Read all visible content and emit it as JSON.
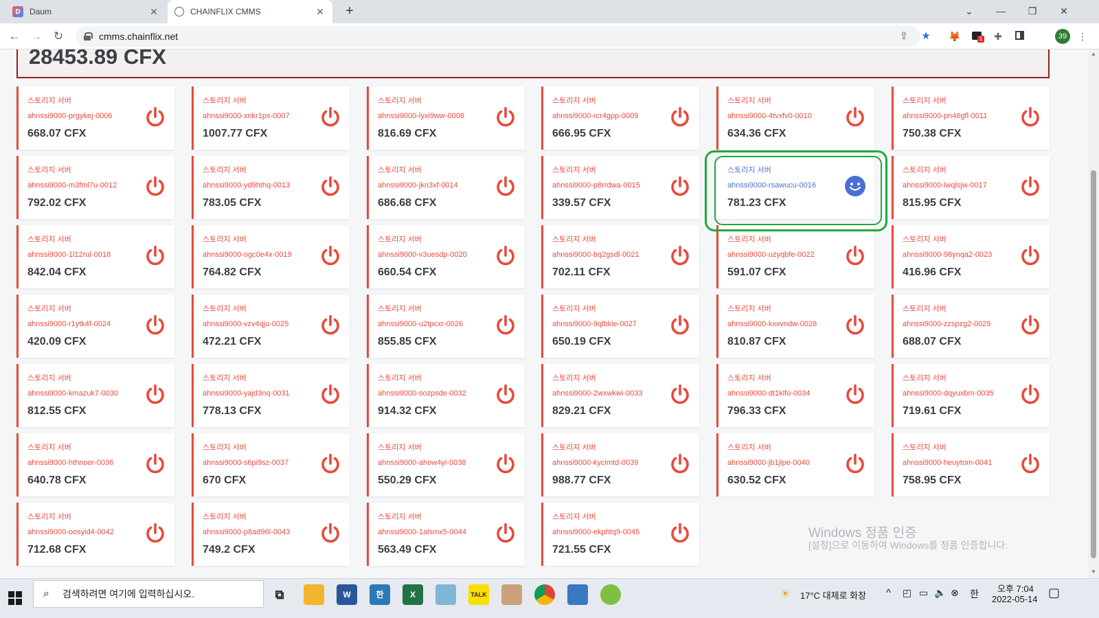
{
  "browser": {
    "tabs": [
      {
        "title": "Daum",
        "active": false,
        "favicon": "daum-icon"
      },
      {
        "title": "CHAINFLIX CMMS",
        "active": true,
        "favicon": "globe-icon"
      }
    ],
    "url": "cmms.chainflix.net",
    "profile_initials": "39",
    "extension_badge": "1"
  },
  "page": {
    "total_balance": "28453.89 CFX",
    "cards": [
      {
        "type": "스토리지 서버",
        "name": "ahnssi9000-prgykej-0006",
        "amount": "668.07 CFX",
        "status": "off"
      },
      {
        "type": "스토리지 서버",
        "name": "ahnssi9000-xnkr1ps-0007",
        "amount": "1007.77 CFX",
        "status": "off"
      },
      {
        "type": "스토리지 서버",
        "name": "ahnssi9000-lyxi9ww-0008",
        "amount": "816.69 CFX",
        "status": "off"
      },
      {
        "type": "스토리지 서버",
        "name": "ahnssi9000-rcr4gpp-0009",
        "amount": "666.95 CFX",
        "status": "off"
      },
      {
        "type": "스토리지 서버",
        "name": "ahnssi9000-4tvxfv0-0010",
        "amount": "634.36 CFX",
        "status": "off"
      },
      {
        "type": "스토리지 서버",
        "name": "ahnssi9000-pn46gfl-0011",
        "amount": "750.38 CFX",
        "status": "off"
      },
      {
        "type": "스토리지 서버",
        "name": "ahnssi9000-m3fml7u-0012",
        "amount": "792.02 CFX",
        "status": "off"
      },
      {
        "type": "스토리지 서버",
        "name": "ahnssi9000-yd9hthq-0013",
        "amount": "783.05 CFX",
        "status": "off"
      },
      {
        "type": "스토리지 서버",
        "name": "ahnssi9000-jkri3xf-0014",
        "amount": "686.68 CFX",
        "status": "off"
      },
      {
        "type": "스토리지 서버",
        "name": "ahnssi9000-p8rrdwa-0015",
        "amount": "339.57 CFX",
        "status": "off"
      },
      {
        "type": "스토리지 서버",
        "name": "ahnssi9000-rsawucu-0016",
        "amount": "781.23 CFX",
        "status": "on"
      },
      {
        "type": "스토리지 서버",
        "name": "ahnssi9000-lwqlsjw-0017",
        "amount": "815.95 CFX",
        "status": "off"
      },
      {
        "type": "스토리지 서버",
        "name": "ahnssi9000-1l12rul-0018",
        "amount": "842.04 CFX",
        "status": "off"
      },
      {
        "type": "스토리지 서버",
        "name": "ahnssi9000-ogc0e4x-0019",
        "amount": "764.82 CFX",
        "status": "off"
      },
      {
        "type": "스토리지 서버",
        "name": "ahnssi9000-v3uesdp-0020",
        "amount": "660.54 CFX",
        "status": "off"
      },
      {
        "type": "스토리지 서버",
        "name": "ahnssi9000-bq2gsdl-0021",
        "amount": "702.11 CFX",
        "status": "off"
      },
      {
        "type": "스토리지 서버",
        "name": "ahnssi9000-uzyqbfe-0022",
        "amount": "591.07 CFX",
        "status": "off"
      },
      {
        "type": "스토리지 서버",
        "name": "ahnssi9000-98ynqa2-0023",
        "amount": "416.96 CFX",
        "status": "off"
      },
      {
        "type": "스토리지 서버",
        "name": "ahnssi9000-r1ytk4f-0024",
        "amount": "420.09 CFX",
        "status": "off"
      },
      {
        "type": "스토리지 서버",
        "name": "ahnssi9000-vzv4qju-0025",
        "amount": "472.21 CFX",
        "status": "off"
      },
      {
        "type": "스토리지 서버",
        "name": "ahnssi9000-u2tpcxr-0026",
        "amount": "855.85 CFX",
        "status": "off"
      },
      {
        "type": "스토리지 서버",
        "name": "ahnssi9000-9qlbkie-0027",
        "amount": "650.19 CFX",
        "status": "off"
      },
      {
        "type": "스토리지 서버",
        "name": "ahnssi9000-kxxvndw-0028",
        "amount": "810.87 CFX",
        "status": "off"
      },
      {
        "type": "스토리지 서버",
        "name": "ahnssi9000-zzspzg2-0029",
        "amount": "688.07 CFX",
        "status": "off"
      },
      {
        "type": "스토리지 서버",
        "name": "ahnssi9000-kmazuk7-0030",
        "amount": "812.55 CFX",
        "status": "off"
      },
      {
        "type": "스토리지 서버",
        "name": "ahnssi9000-yajd3nq-0031",
        "amount": "778.13 CFX",
        "status": "off"
      },
      {
        "type": "스토리지 서버",
        "name": "ahnssi9000-sozpsde-0032",
        "amount": "914.32 CFX",
        "status": "off"
      },
      {
        "type": "스토리지 서버",
        "name": "ahnssi9000-2wxwkwi-0033",
        "amount": "829.21 CFX",
        "status": "off"
      },
      {
        "type": "스토리지 서버",
        "name": "ahnssi9000-dt1klfo-0034",
        "amount": "796.33 CFX",
        "status": "off"
      },
      {
        "type": "스토리지 서버",
        "name": "ahnssi9000-dqyuxbm-0035",
        "amount": "719.61 CFX",
        "status": "off"
      },
      {
        "type": "스토리지 서버",
        "name": "ahnssi9000-hthnoor-0036",
        "amount": "640.78 CFX",
        "status": "off"
      },
      {
        "type": "스토리지 서버",
        "name": "ahnssi9000-s6pi9sz-0037",
        "amount": "670 CFX",
        "status": "off"
      },
      {
        "type": "스토리지 서버",
        "name": "ahnssi9000-ahow4yi-0038",
        "amount": "550.29 CFX",
        "status": "off"
      },
      {
        "type": "스토리지 서버",
        "name": "ahnssi9000-kycimtd-0039",
        "amount": "988.77 CFX",
        "status": "off"
      },
      {
        "type": "스토리지 서버",
        "name": "ahnssi9000-jb1jlpe-0040",
        "amount": "630.52 CFX",
        "status": "off"
      },
      {
        "type": "스토리지 서버",
        "name": "ahnssi9000-heuytom-0041",
        "amount": "758.95 CFX",
        "status": "off"
      },
      {
        "type": "스토리지 서버",
        "name": "ahnssi9000-oosyid4-0042",
        "amount": "712.68 CFX",
        "status": "off"
      },
      {
        "type": "스토리지 서버",
        "name": "ahnssi9000-p8ad96l-0043",
        "amount": "749.2 CFX",
        "status": "off"
      },
      {
        "type": "스토리지 서버",
        "name": "ahnssi9000-1alsmx5-0044",
        "amount": "563.49 CFX",
        "status": "off"
      },
      {
        "type": "스토리지 서버",
        "name": "ahnssi9000-ekphtq9-0045",
        "amount": "721.55 CFX",
        "status": "off"
      }
    ]
  },
  "watermark": {
    "title": "Windows 정품 인증",
    "subtitle": "[설정]으로 이동하여 Windows를 정품 인증합니다."
  },
  "taskbar": {
    "search_placeholder": "검색하려면 여기에 입력하십시오.",
    "weather": "17°C  대체로 화창",
    "ime": "한",
    "time": "오후 7:04",
    "date": "2022-05-14"
  },
  "colors": {
    "off_accent": "#e84a3b",
    "on_accent": "#4b6fd6",
    "highlight": "#22a83c"
  }
}
